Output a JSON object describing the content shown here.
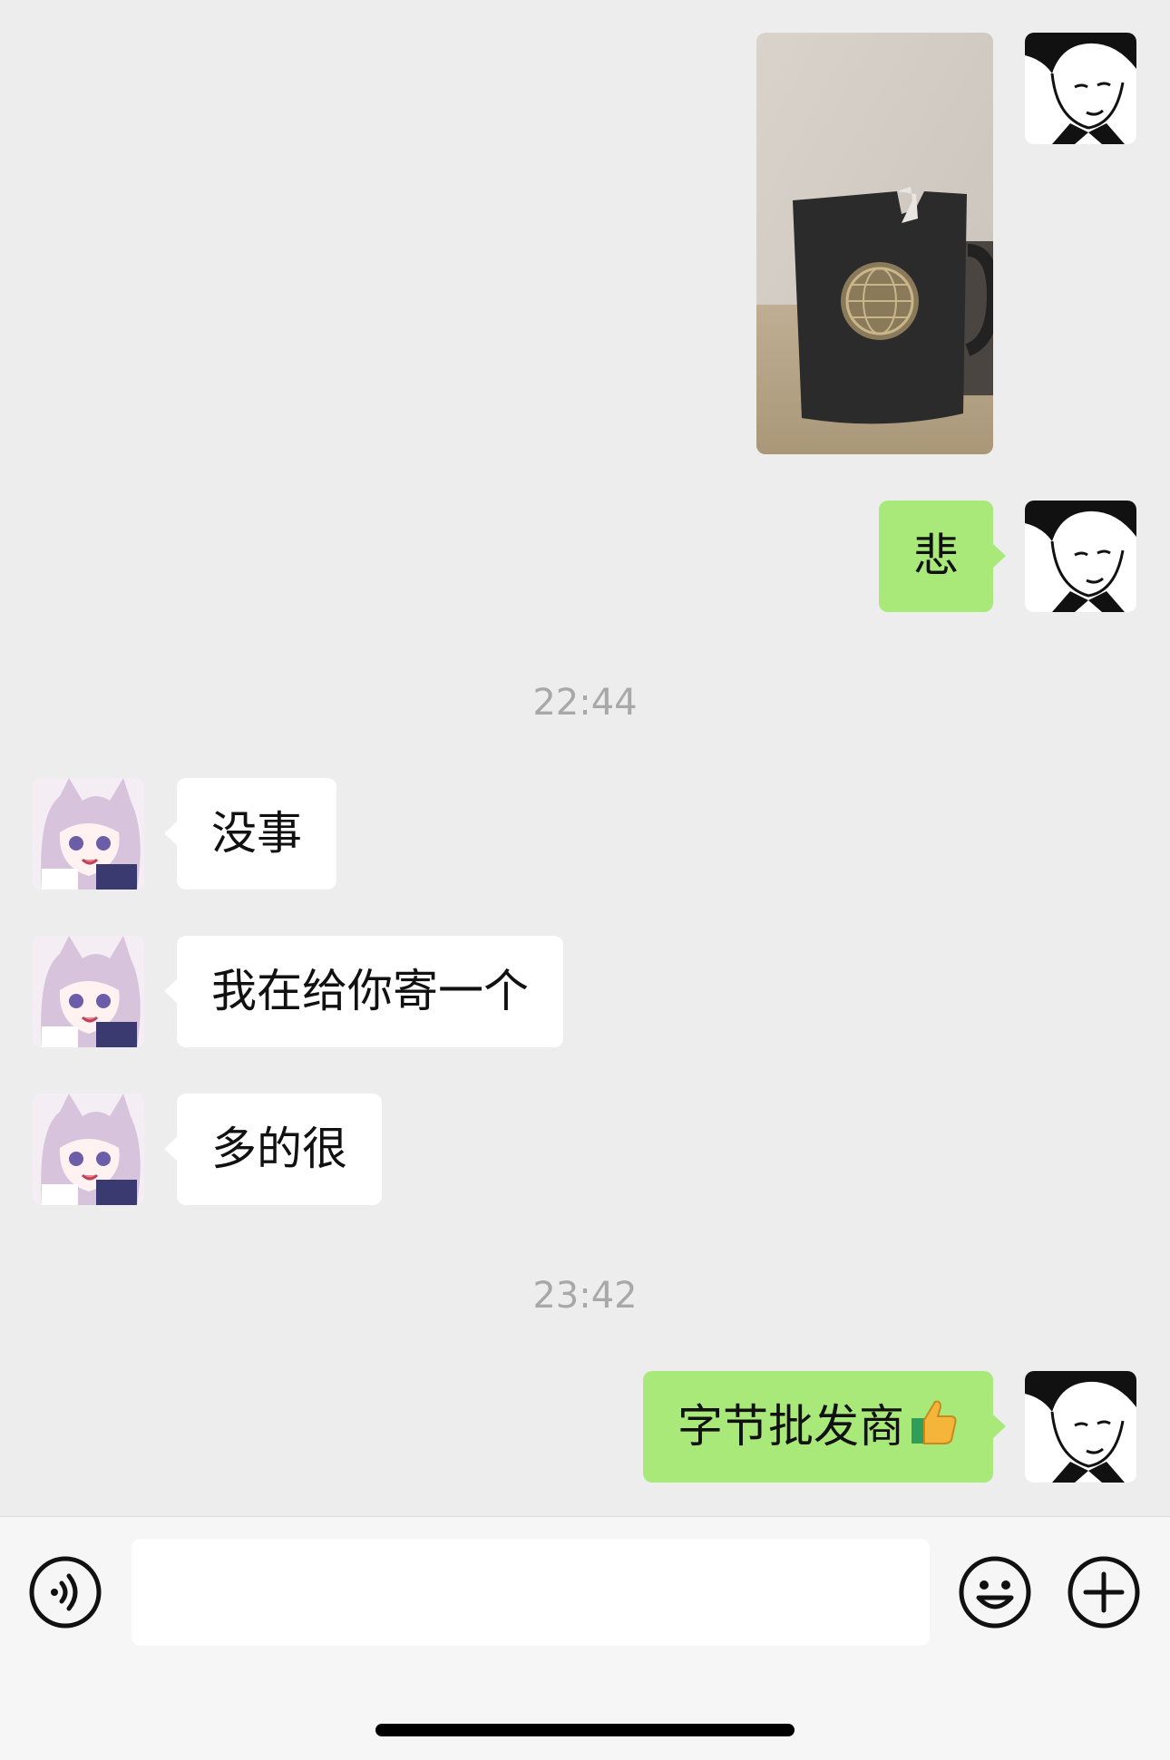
{
  "colors": {
    "background": "#ededed",
    "incoming_bubble": "#ffffff",
    "outgoing_bubble": "#a9e97a",
    "timestamp": "#a8a8a8",
    "input_bar": "#f6f6f6"
  },
  "messages": [
    {
      "from": "me",
      "type": "image",
      "description": "broken-mug-photo"
    },
    {
      "from": "me",
      "type": "text",
      "text": "悲"
    },
    {
      "type": "time",
      "text": "22:44"
    },
    {
      "from": "them",
      "type": "text",
      "text": "没事"
    },
    {
      "from": "them",
      "type": "text",
      "text": "我在给你寄一个"
    },
    {
      "from": "them",
      "type": "text",
      "text": "多的很"
    },
    {
      "type": "time",
      "text": "23:42"
    },
    {
      "from": "me",
      "type": "text",
      "text": "字节批发商",
      "emoji": "thumbs-up"
    }
  ],
  "input": {
    "value": "",
    "placeholder": ""
  },
  "icons": {
    "voice": "voice-icon",
    "emoji": "smiley-icon",
    "more": "plus-icon"
  }
}
